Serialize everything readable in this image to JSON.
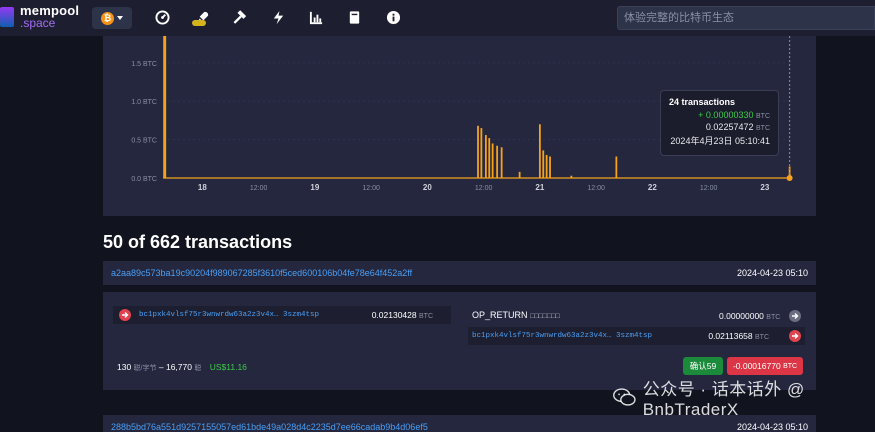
{
  "logo": {
    "line1": "mempool",
    "line2": ".space"
  },
  "network": {
    "coin_symbol": "₿"
  },
  "nav": {
    "icons": [
      "dashboard-icon",
      "rocket-icon",
      "hammer-icon",
      "lightning-icon",
      "chart-icon",
      "book-icon",
      "info-icon"
    ]
  },
  "search": {
    "placeholder": "体验完整的比特币生态"
  },
  "chart": {
    "y_ticks": [
      "1.5 BTC",
      "1.0 BTC",
      "0.5 BTC",
      "0.0 BTC"
    ],
    "x_ticks": [
      "18",
      "12:00",
      "19",
      "12:00",
      "20",
      "12:00",
      "21",
      "12:00",
      "22",
      "12:00",
      "23"
    ]
  },
  "chart_data": {
    "type": "bar",
    "ylim": [
      0,
      1.85
    ],
    "y_unit": "BTC",
    "x_ticks": [
      "18",
      "12:00",
      "19",
      "12:00",
      "20",
      "12:00",
      "21",
      "12:00",
      "22",
      "12:00",
      "23"
    ],
    "x_day_range": [
      17.65,
      23.25
    ],
    "points": [
      {
        "x": 17.66,
        "y": 1.85
      },
      {
        "x": 17.67,
        "y": 1.85
      },
      {
        "x": 20.45,
        "y": 0.68
      },
      {
        "x": 20.48,
        "y": 0.65
      },
      {
        "x": 20.52,
        "y": 0.56
      },
      {
        "x": 20.55,
        "y": 0.52
      },
      {
        "x": 20.58,
        "y": 0.45
      },
      {
        "x": 20.62,
        "y": 0.42
      },
      {
        "x": 20.66,
        "y": 0.4
      },
      {
        "x": 20.82,
        "y": 0.08
      },
      {
        "x": 21.0,
        "y": 0.7
      },
      {
        "x": 21.03,
        "y": 0.36
      },
      {
        "x": 21.06,
        "y": 0.3
      },
      {
        "x": 21.09,
        "y": 0.28
      },
      {
        "x": 21.28,
        "y": 0.03
      },
      {
        "x": 21.68,
        "y": 0.28
      },
      {
        "x": 23.22,
        "y": 0.15
      }
    ]
  },
  "tooltip": {
    "count": "24 transactions",
    "plus": "+ 0.00000330",
    "plus_unit": "BTC",
    "total": "0.02257472",
    "total_unit": "BTC",
    "time": "2024年4月23日 05:10:41"
  },
  "heading": "50 of 662 transactions",
  "tx1": {
    "txid": "a2aa89c573ba19c90204f989067285f3610f5ced600106b04fe78e64f452a2ff",
    "time": "2024-04-23 05:10",
    "input": {
      "address": "bc1pxk4vlsf75r3wnwrdw63a2z3v4x… 3szm4tsp",
      "amount": "0.02130428",
      "unit": "BTC"
    },
    "outputs": [
      {
        "label": "OP_RETURN",
        "sub": "□□□□□□□",
        "amount": "0.00000000",
        "unit": "BTC"
      },
      {
        "address": "bc1pxk4vlsf75r3wnwrdw63a2z3v4x… 3szm4tsp",
        "amount": "0.02113658",
        "unit": "BTC"
      }
    ],
    "fee_rate": "130",
    "fee_rate_unit": "聪/字节",
    "fee_total": "– 16,770",
    "fee_total_unit": "聪",
    "usd": "US$11.16",
    "confirm": "确认59",
    "delta": "-0.00016770",
    "delta_unit": "BTC"
  },
  "tx2": {
    "txid": "288b5bd76a551d9257155057ed61bde49a028d4c2235d7ee66cadab9b4d06ef5",
    "time": "2024-04-23 05:10"
  },
  "watermark": {
    "text": "公众号 · 话本话外 @ BnbTraderX"
  }
}
